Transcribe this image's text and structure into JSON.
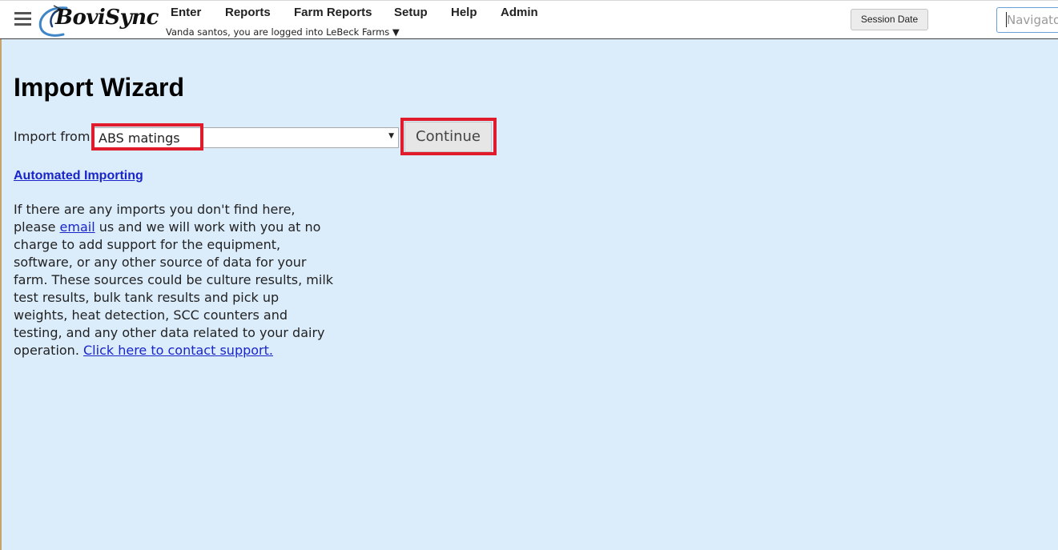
{
  "header": {
    "logo_text": "BoviSync",
    "nav": [
      "Enter",
      "Reports",
      "Farm Reports",
      "Setup",
      "Help",
      "Admin"
    ],
    "user_line": "Vanda santos, you are logged into LeBeck Farms ▼",
    "session_date_label": "Session Date",
    "navigator_placeholder": "Navigator"
  },
  "main": {
    "title": "Import Wizard",
    "import_label": "Import from:",
    "import_selected": "ABS matings",
    "continue_label": "Continue",
    "automated_link": "Automated Importing",
    "info": {
      "before_email": "If there are any imports you don't find here, please ",
      "email_link": "email",
      "after_email": " us and we will work with you at no charge to add support for the equipment, software, or any other source of data for your farm. These sources could be culture results, milk test results, bulk tank results and pick up weights, heat detection, SCC counters and testing, and any other data related to your dairy operation. ",
      "contact_link": "Click here to contact support."
    }
  },
  "colors": {
    "background": "#dbecfb",
    "link": "#1a25c9",
    "highlight": "#e01b2c"
  },
  "icons": {
    "menu": "hamburger-menu-icon",
    "dropdown": "dropdown-arrow-icon"
  }
}
